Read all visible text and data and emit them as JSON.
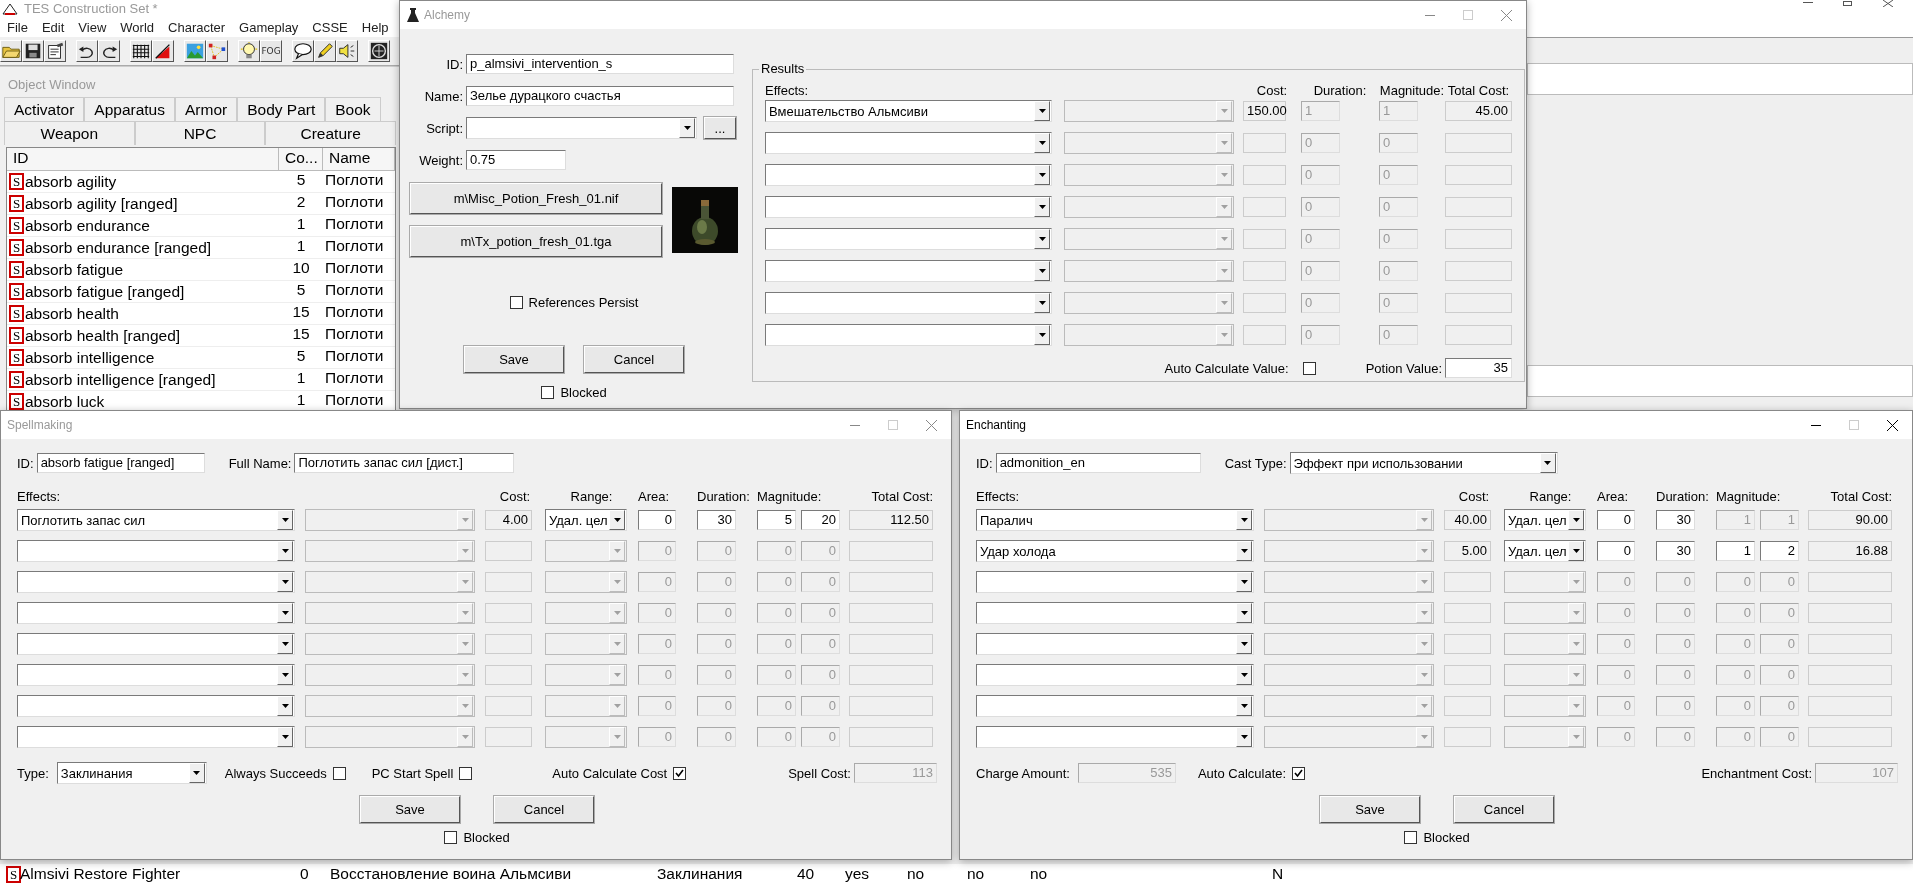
{
  "main_window": {
    "title": "TES Construction Set *",
    "menu": [
      "File",
      "Edit",
      "View",
      "World",
      "Character",
      "Gameplay",
      "CSSE",
      "Help"
    ],
    "fog_label": "FOG"
  },
  "object_window": {
    "title": "Object Window",
    "tab_rows": [
      [
        "Activator",
        "Apparatus",
        "Armor",
        "Body Part",
        "Book"
      ],
      [
        "Weapon",
        "NPC",
        "Creature"
      ]
    ],
    "columns": [
      "ID",
      "Co...",
      "Name"
    ],
    "rows": [
      {
        "badge": "S",
        "id": "absorb agility",
        "count": "5",
        "name": "Поглоти"
      },
      {
        "badge": "S",
        "id": "absorb agility [ranged]",
        "count": "2",
        "name": "Поглоти"
      },
      {
        "badge": "S",
        "id": "absorb endurance",
        "count": "1",
        "name": "Поглоти"
      },
      {
        "badge": "S",
        "id": "absorb endurance [ranged]",
        "count": "1",
        "name": "Поглоти"
      },
      {
        "badge": "S",
        "id": "absorb fatigue",
        "count": "10",
        "name": "Поглоти"
      },
      {
        "badge": "S",
        "id": "absorb fatigue [ranged]",
        "count": "5",
        "name": "Поглоти"
      },
      {
        "badge": "S",
        "id": "absorb health",
        "count": "15",
        "name": "Поглоти"
      },
      {
        "badge": "S",
        "id": "absorb health [ranged]",
        "count": "15",
        "name": "Поглоти"
      },
      {
        "badge": "S",
        "id": "absorb intelligence",
        "count": "5",
        "name": "Поглоти"
      },
      {
        "badge": "S",
        "id": "absorb intelligence [ranged]",
        "count": "1",
        "name": "Поглоти"
      },
      {
        "badge": "S",
        "id": "absorb luck",
        "count": "1",
        "name": "Поглоти"
      }
    ],
    "bottom_row": {
      "badge": "S",
      "cells": [
        "Almsivi Restore Fighter",
        "0",
        "Восстановление воина Альмсиви",
        "Заклинания",
        "40",
        "yes",
        "no",
        "no",
        "no",
        "N"
      ]
    }
  },
  "alchemy": {
    "title": "Alchemy",
    "active": false,
    "id_label": "ID:",
    "id": "p_almsivi_intervention_s",
    "name_label": "Name:",
    "name": "Зелье дурацкого счастья",
    "script_label": "Script:",
    "browse_label": "...",
    "weight_label": "Weight:",
    "weight": "0.75",
    "model": "m\\Misc_Potion_Fresh_01.nif",
    "icon": "m\\Tx_potion_fresh_01.tga",
    "references_persist": {
      "label": "References Persist",
      "checked": false
    },
    "buttons": [
      "Save",
      "Cancel"
    ],
    "blocked": {
      "label": "Blocked",
      "checked": false
    },
    "results": {
      "title": "Results",
      "headers": {
        "effects": "Effects:",
        "cost": "Cost:",
        "duration": "Duration:",
        "magnitude": "Magnitude:",
        "total_cost": "Total Cost:"
      },
      "effects": [
        {
          "effect": "Вмешательство Альмсиви",
          "cost": "150.00",
          "duration": "1",
          "magnitude": "1",
          "total": "45.00"
        },
        {
          "duration": "0",
          "magnitude": "0"
        },
        {
          "duration": "0",
          "magnitude": "0"
        },
        {
          "duration": "0",
          "magnitude": "0"
        },
        {
          "duration": "0",
          "magnitude": "0"
        },
        {
          "duration": "0",
          "magnitude": "0"
        },
        {
          "duration": "0",
          "magnitude": "0"
        },
        {
          "duration": "0",
          "magnitude": "0"
        }
      ],
      "auto_value": {
        "label": "Auto Calculate Value:",
        "checked": false
      },
      "potion_value_label": "Potion Value:",
      "potion_value": "35"
    }
  },
  "spellmaking": {
    "title": "Spellmaking",
    "active": false,
    "id_label": "ID:",
    "id": "absorb fatigue [ranged]",
    "full_name_label": "Full Name:",
    "full_name": "Поглотить запас сил [дист.]",
    "headers": {
      "effects": "Effects:",
      "cost": "Cost:",
      "range": "Range:",
      "area": "Area:",
      "duration": "Duration:",
      "magnitude": "Magnitude:",
      "total_cost": "Total Cost:"
    },
    "effects": [
      {
        "effect": "Поглотить запас сил",
        "cost": "4.00",
        "range": "Удал. цел",
        "area": "0",
        "duration": "30",
        "mag_min": "5",
        "mag_max": "20",
        "total": "112.50",
        "disabled": false,
        "magnitude_disabled": false
      },
      {
        "area": "0",
        "duration": "0",
        "mag_min": "0",
        "mag_max": "0",
        "disabled": true,
        "magnitude_disabled": true
      },
      {
        "area": "0",
        "duration": "0",
        "mag_min": "0",
        "mag_max": "0",
        "disabled": true,
        "magnitude_disabled": true
      },
      {
        "area": "0",
        "duration": "0",
        "mag_min": "0",
        "mag_max": "0",
        "disabled": true,
        "magnitude_disabled": true
      },
      {
        "area": "0",
        "duration": "0",
        "mag_min": "0",
        "mag_max": "0",
        "disabled": true,
        "magnitude_disabled": true
      },
      {
        "area": "0",
        "duration": "0",
        "mag_min": "0",
        "mag_max": "0",
        "disabled": true,
        "magnitude_disabled": true
      },
      {
        "area": "0",
        "duration": "0",
        "mag_min": "0",
        "mag_max": "0",
        "disabled": true,
        "magnitude_disabled": true
      },
      {
        "area": "0",
        "duration": "0",
        "mag_min": "0",
        "mag_max": "0",
        "disabled": true,
        "magnitude_disabled": true
      }
    ],
    "type_label": "Type:",
    "type": "Заклинания",
    "options": [
      {
        "label": "Always Succeeds",
        "checked": false
      },
      {
        "label": "PC Start Spell",
        "checked": false
      },
      {
        "label": "Auto Calculate Cost",
        "checked": true
      }
    ],
    "spell_cost_label": "Spell Cost:",
    "spell_cost": "113",
    "buttons": [
      "Save",
      "Cancel"
    ],
    "blocked": {
      "label": "Blocked",
      "checked": false
    }
  },
  "enchanting": {
    "title": "Enchanting",
    "active": true,
    "id_label": "ID:",
    "id": "admonition_en",
    "cast_type_label": "Cast Type:",
    "cast_type": "Эффект при использовании",
    "headers": {
      "effects": "Effects:",
      "cost": "Cost:",
      "range": "Range:",
      "area": "Area:",
      "duration": "Duration:",
      "magnitude": "Magnitude:",
      "total_cost": "Total Cost:"
    },
    "effects": [
      {
        "effect": "Паралич",
        "cost": "40.00",
        "range": "Удал. цел",
        "area": "0",
        "duration": "30",
        "mag_min": "1",
        "mag_max": "1",
        "total": "90.00",
        "disabled": false,
        "magnitude_disabled": true
      },
      {
        "effect": "Удар холода",
        "cost": "5.00",
        "range": "Удал. цел",
        "area": "0",
        "duration": "30",
        "mag_min": "1",
        "mag_max": "2",
        "total": "16.88",
        "disabled": false,
        "magnitude_disabled": false
      },
      {
        "area": "0",
        "duration": "0",
        "mag_min": "0",
        "mag_max": "0",
        "disabled": true,
        "magnitude_disabled": true
      },
      {
        "area": "0",
        "duration": "0",
        "mag_min": "0",
        "mag_max": "0",
        "disabled": true,
        "magnitude_disabled": true
      },
      {
        "area": "0",
        "duration": "0",
        "mag_min": "0",
        "mag_max": "0",
        "disabled": true,
        "magnitude_disabled": true
      },
      {
        "area": "0",
        "duration": "0",
        "mag_min": "0",
        "mag_max": "0",
        "disabled": true,
        "magnitude_disabled": true
      },
      {
        "area": "0",
        "duration": "0",
        "mag_min": "0",
        "mag_max": "0",
        "disabled": true,
        "magnitude_disabled": true
      },
      {
        "area": "0",
        "duration": "0",
        "mag_min": "0",
        "mag_max": "0",
        "disabled": true,
        "magnitude_disabled": true
      }
    ],
    "charge_label": "Charge Amount:",
    "charge": "535",
    "auto_calc": {
      "label": "Auto Calculate:",
      "checked": true
    },
    "cost_label": "Enchantment Cost:",
    "cost": "107",
    "buttons": [
      "Save",
      "Cancel"
    ],
    "blocked": {
      "label": "Blocked",
      "checked": false
    }
  }
}
